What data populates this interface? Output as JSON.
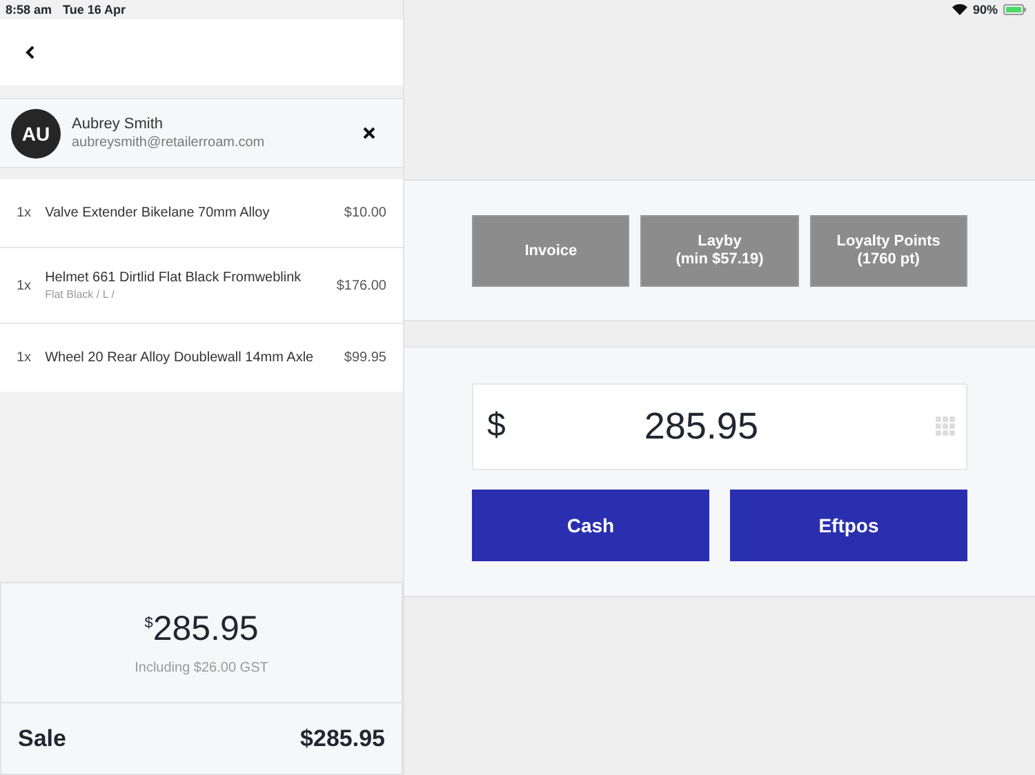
{
  "status_bar": {
    "time": "8:58 am",
    "date": "Tue 16 Apr",
    "battery": "90%"
  },
  "customer": {
    "initials": "AU",
    "name": "Aubrey Smith",
    "email": "aubreysmith@retailerroam.com"
  },
  "cart_items": [
    {
      "quantity": "1x",
      "name": "Valve Extender Bikelane 70mm Alloy",
      "price": "$10.00"
    },
    {
      "quantity": "1x",
      "name": "Helmet 661 Dirtlid Flat Black Fromweblink",
      "variant": "Flat Black / L /",
      "price": "$176.00"
    },
    {
      "quantity": "1x",
      "name": "Wheel 20 Rear Alloy Doublewall 14mm Axle",
      "price": "$99.95"
    }
  ],
  "total": {
    "currency": "$",
    "amount": "285.95",
    "tax_note": "Including $26.00 GST"
  },
  "sale": {
    "label": "Sale",
    "amount": "$285.95"
  },
  "payment_options": [
    {
      "lines": [
        "Invoice"
      ]
    },
    {
      "lines": [
        "Layby",
        "(min $57.19)"
      ]
    },
    {
      "lines": [
        "Loyalty Points",
        "(1760 pt)"
      ]
    }
  ],
  "amount_field": {
    "currency": "$",
    "value": "285.95"
  },
  "tender_buttons": [
    "Cash",
    "Eftpos"
  ]
}
